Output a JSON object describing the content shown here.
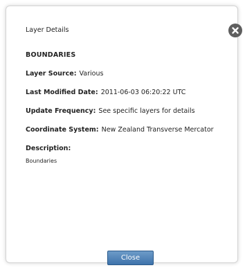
{
  "dialog": {
    "title": "Layer Details",
    "layer_name": "BOUNDARIES",
    "fields": [
      {
        "label": "Layer Source:",
        "value": "Various"
      },
      {
        "label": "Last Modified Date:",
        "value": "2011-06-03 06:20:22 UTC"
      },
      {
        "label": "Update Frequency:",
        "value": "See specific layers for details"
      },
      {
        "label": "Coordinate System:",
        "value": "New Zealand Transverse Mercator"
      }
    ],
    "description_label": "Description:",
    "description_value": "Boundaries",
    "close_button_label": "Close",
    "close_icon": "close-icon"
  },
  "colors": {
    "button_top": "#6d9bc8",
    "button_bottom": "#3e73ab",
    "close_icon_bg": "#5e5e5e"
  }
}
